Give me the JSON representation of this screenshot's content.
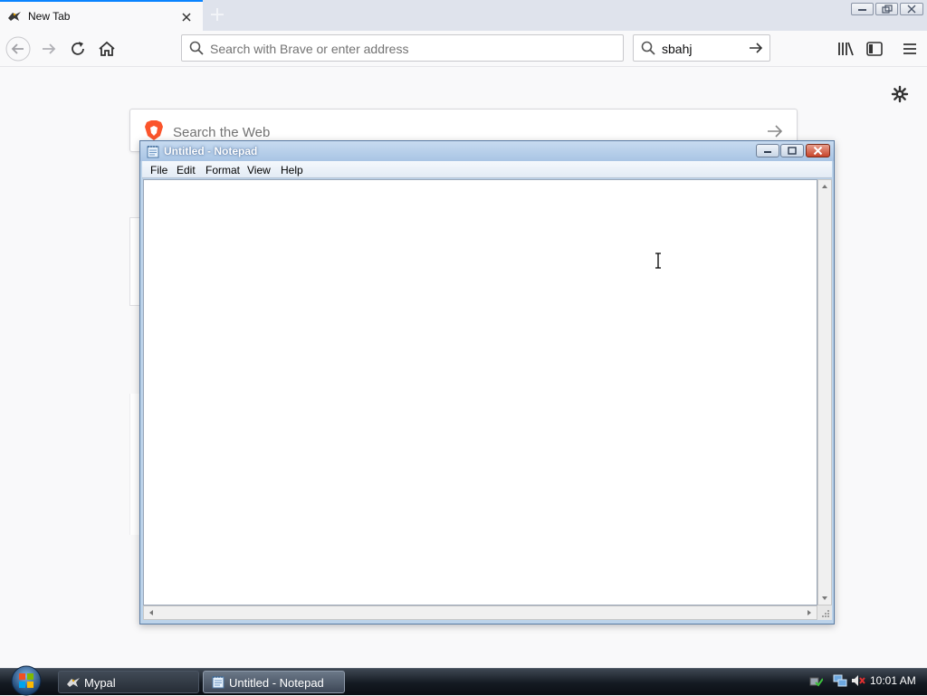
{
  "browser": {
    "tab": {
      "title": "New Tab"
    },
    "urlbar": {
      "placeholder": "Search with Brave or enter address"
    },
    "searchbar": {
      "value": "sbahj"
    },
    "newtab": {
      "web_search_placeholder": "Search the Web"
    }
  },
  "notepad": {
    "title": "Untitled - Notepad",
    "menu": [
      "File",
      "Edit",
      "Format",
      "View",
      "Help"
    ],
    "content": ""
  },
  "taskbar": {
    "buttons": [
      {
        "label": "Mypal"
      },
      {
        "label": "Untitled - Notepad"
      }
    ],
    "clock": "10:01 AM"
  },
  "colors": {
    "tab_accent": "#0a84ff",
    "brave_orange": "#fb542b",
    "notepad_title_bg": "#bcd3ea",
    "taskbar_bg": "#141a22"
  },
  "icons": {
    "tab_favicon": "mypal-bird-icon",
    "back": "arrow-left-icon",
    "forward": "arrow-right-icon",
    "reload": "reload-icon",
    "home": "home-icon",
    "library": "library-icon",
    "sidebar": "sidebar-icon",
    "menu": "hamburger-menu-icon",
    "settings": "gear-icon",
    "web_search": "brave-lion-icon"
  }
}
